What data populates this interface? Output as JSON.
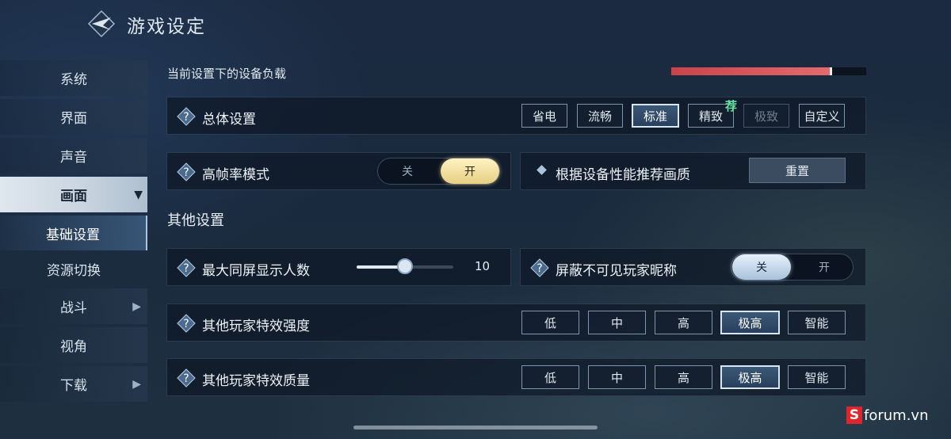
{
  "header": {
    "title": "游戏设定"
  },
  "sidebar": {
    "items": [
      {
        "label": "系统"
      },
      {
        "label": "界面"
      },
      {
        "label": "声音"
      },
      {
        "label": "画面"
      },
      {
        "label": "基础设置"
      },
      {
        "label": "资源切换"
      },
      {
        "label": "战斗"
      },
      {
        "label": "视角"
      },
      {
        "label": "下载"
      }
    ]
  },
  "device_load": {
    "label": "当前设置下的设备负载",
    "fraction": 0.82
  },
  "overall": {
    "label": "总体设置",
    "options": [
      "省电",
      "流畅",
      "标准",
      "精致",
      "极致",
      "自定义"
    ],
    "selected": "标准",
    "recommended_badge": "荐"
  },
  "high_fps": {
    "label": "高帧率模式",
    "off": "关",
    "on": "开",
    "value": "开"
  },
  "recommend_quality": {
    "label": "根据设备性能推荐画质",
    "reset_label": "重置"
  },
  "other_section": {
    "title": "其他设置"
  },
  "max_players": {
    "label": "最大同屏显示人数",
    "value": "10",
    "fraction": 0.5
  },
  "hide_names": {
    "label": "屏蔽不可见玩家昵称",
    "off": "关",
    "on": "开",
    "value": "关"
  },
  "effect_strength": {
    "label": "其他玩家特效强度",
    "options": [
      "低",
      "中",
      "高",
      "极高",
      "智能"
    ],
    "selected": "极高"
  },
  "effect_quality": {
    "label": "其他玩家特效质量",
    "options": [
      "低",
      "中",
      "高",
      "极高",
      "智能"
    ],
    "selected": "极高"
  },
  "watermark": {
    "text": "forum.vn",
    "badge": "S"
  }
}
